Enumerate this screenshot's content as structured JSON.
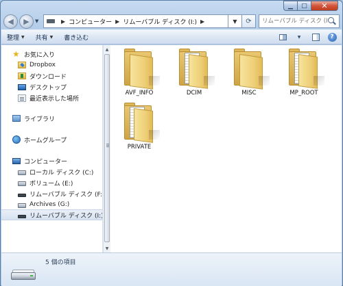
{
  "address": {
    "segments": [
      "コンピューター",
      "リムーバブル ディスク (I:)"
    ]
  },
  "search": {
    "placeholder": "リムーバブル ディスク (I:)の検索"
  },
  "toolbar": {
    "organize": "整理",
    "share": "共有",
    "burn": "書き込む"
  },
  "nav": {
    "favorites": "お気に入り",
    "dropbox": "Dropbox",
    "downloads": "ダウンロード",
    "desktop": "デスクトップ",
    "recent": "最近表示した場所",
    "libraries": "ライブラリ",
    "homegroup": "ホームグループ",
    "computer": "コンピューター",
    "drive_c": "ローカル ディスク (C:)",
    "drive_e": "ボリューム (E:)",
    "drive_f": "リムーバブル ディスク (F:)",
    "drive_g": "Archives (G:)",
    "drive_i": "リムーバブル ディスク (I:)"
  },
  "folders": [
    "AVF_INFO",
    "DCIM",
    "MISC",
    "MP_ROOT",
    "PRIVATE"
  ],
  "details": {
    "count": "5 個の項目"
  },
  "colors": {
    "window_frame": "#b4cde9",
    "selected_nav": "#d6e2f0",
    "folder": "#efd079"
  }
}
